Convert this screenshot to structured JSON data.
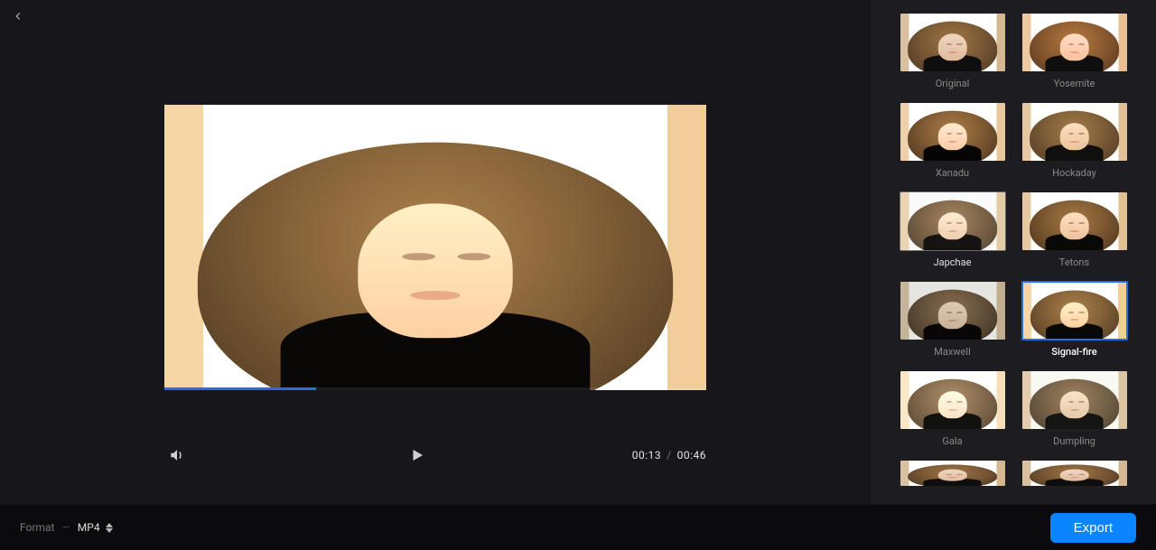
{
  "nav": {
    "back": "back"
  },
  "player": {
    "current_time": "00:13",
    "separator": "/",
    "duration": "00:46",
    "progress_percent": 28
  },
  "filters": [
    {
      "label": "Original",
      "tint": "tint-original",
      "state": "normal"
    },
    {
      "label": "Yosemite",
      "tint": "tint-yosemite",
      "state": "normal"
    },
    {
      "label": "Xanadu",
      "tint": "tint-xanadu",
      "state": "normal"
    },
    {
      "label": "Hockaday",
      "tint": "tint-hockaday",
      "state": "normal"
    },
    {
      "label": "Japchae",
      "tint": "tint-japchae",
      "state": "hover"
    },
    {
      "label": "Tetons",
      "tint": "tint-tetons",
      "state": "normal"
    },
    {
      "label": "Maxwell",
      "tint": "tint-maxwell",
      "state": "normal"
    },
    {
      "label": "Signal-fire",
      "tint": "tint-signal",
      "state": "selected"
    },
    {
      "label": "Gala",
      "tint": "tint-gala",
      "state": "normal"
    },
    {
      "label": "Dumpling",
      "tint": "tint-dumpling",
      "state": "normal"
    },
    {
      "label": "",
      "tint": "tint-original",
      "state": "partial"
    },
    {
      "label": "",
      "tint": "tint-original",
      "state": "partial"
    }
  ],
  "footer": {
    "format_label": "Format",
    "dash": "—",
    "format_value": "MP4",
    "export_label": "Export"
  }
}
